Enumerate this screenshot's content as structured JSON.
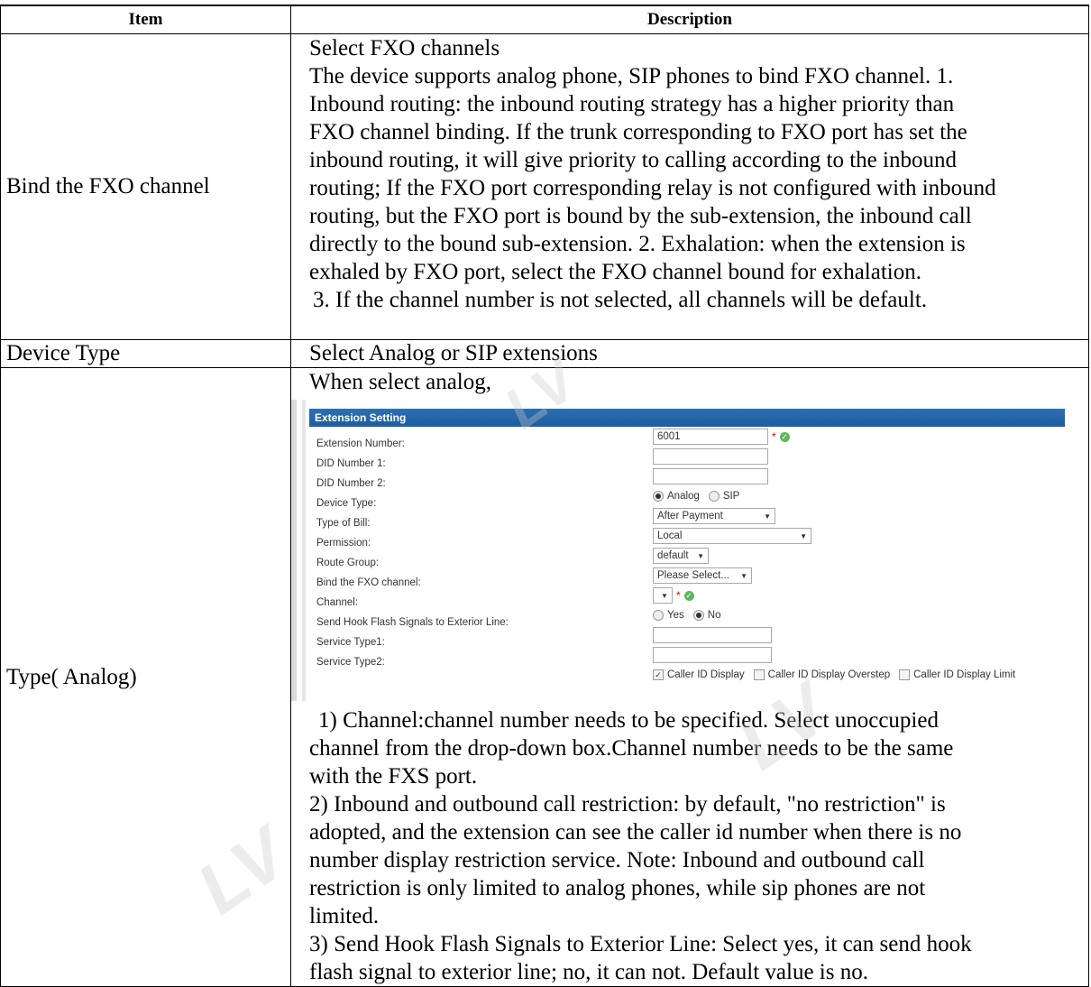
{
  "table": {
    "headers": {
      "item": "Item",
      "description": "Description"
    },
    "rows": {
      "fxo": {
        "item": "Bind the FXO channel",
        "lines": [
          "Select FXO channels",
          "The device supports analog phone, SIP phones to bind FXO channel. 1.",
          "Inbound routing: the inbound routing strategy has a higher priority than",
          "FXO channel binding. If the trunk corresponding to FXO port has set the",
          "inbound routing, it will give priority to calling according to the inbound",
          "routing; If the FXO port corresponding relay is not configured with inbound",
          "routing, but the FXO port is bound by the sub-extension, the inbound call",
          "directly to the bound sub-extension. 2. Exhalation: when the extension is",
          "exhaled by FXO port, select the FXO channel bound for exhalation.",
          "3. If the channel number is not selected, all channels will be default."
        ]
      },
      "device_type": {
        "item": "Device Type",
        "description": "Select Analog or SIP extensions"
      },
      "analog": {
        "item": "Type( Analog)",
        "intro": "When select analog,",
        "lines": [
          "1) Channel:channel number needs to be specified. Select unoccupied",
          "channel from the drop-down box.Channel number needs to be the same",
          "with the FXS port.",
          "2)  Inbound and outbound call restriction: by default, \"no restriction\" is",
          "adopted, and the extension can see the caller id number when there is no",
          "number display restriction service. Note: Inbound and outbound call",
          "restriction is only limited to analog phones, while sip phones are not",
          "limited.",
          "3)  Send Hook Flash Signals to Exterior Line: Select yes, it can send hook",
          "flash signal to exterior line; no, it can not. Default value is no."
        ]
      }
    }
  },
  "screenshot": {
    "header": "Extension Setting",
    "fields": {
      "ext_number": {
        "label": "Extension Number:",
        "value": "6001"
      },
      "did1": {
        "label": "DID Number 1:",
        "value": ""
      },
      "did2": {
        "label": "DID Number 2:",
        "value": ""
      },
      "device_type": {
        "label": "Device Type:",
        "opt1": "Analog",
        "opt2": "SIP"
      },
      "bill": {
        "label": "Type of Bill:",
        "value": "After Payment"
      },
      "permission": {
        "label": "Permission:",
        "value": "Local"
      },
      "route_group": {
        "label": "Route Group:",
        "value": "default"
      },
      "bind_fxo": {
        "label": "Bind the FXO channel:",
        "value": "Please Select..."
      },
      "channel": {
        "label": "Channel:",
        "value": ""
      },
      "hook_flash": {
        "label": "Send Hook Flash Signals to Exterior Line:",
        "opt1": "Yes",
        "opt2": "No"
      },
      "service1": {
        "label": "Service Type1:",
        "value": ""
      },
      "service2": {
        "label": "Service Type2:",
        "value": ""
      }
    },
    "checkboxes": {
      "caller_id": "Caller ID Display",
      "overstep": "Caller ID Display Overstep",
      "limit": "Caller ID Display Limit"
    }
  }
}
